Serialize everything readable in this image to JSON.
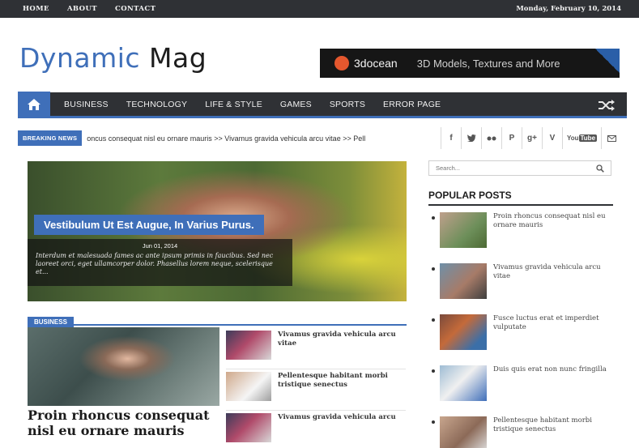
{
  "topbar": {
    "links": [
      "HOME",
      "ABOUT",
      "CONTACT"
    ],
    "date": "Monday, February 10, 2014"
  },
  "header": {
    "logo_part1": "Dynamic",
    "logo_part2": "Mag",
    "banner_brand": "3docean",
    "banner_text": "3D Models, Textures and More"
  },
  "nav": {
    "items": [
      "BUSINESS",
      "TECHNOLOGY",
      "LIFE & STYLE",
      "GAMES",
      "SPORTS",
      "ERROR PAGE"
    ],
    "accent": "#3f6fb9",
    "bar_color": "#2f3135"
  },
  "breaking": {
    "label": "BREAKING NEWS",
    "ticker": "oncus consequat nisl eu ornare mauris  >> Vivamus gravida vehicula arcu vitae  >> Pell",
    "social_icons": [
      "facebook-icon",
      "twitter-icon",
      "flickr-icon",
      "pinterest-icon",
      "googleplus-icon",
      "vimeo-icon",
      "youtube-icon",
      "email-icon"
    ]
  },
  "hero": {
    "title": "Vestibulum Ut Est Augue, In Varius Purus.",
    "date": "Jun 01, 2014",
    "excerpt": "Interdum et malesuada fames ac ante ipsum primis in faucibus. Sed nec laoreet orci, eget ullamcorper dolor. Phasellus lorem neque, scelerisque et..."
  },
  "business": {
    "label": "BUSINESS",
    "feature_title": "Proin rhoncus consequat nisl eu ornare mauris",
    "items": [
      "Vivamus gravida vehicula arcu vitae",
      "Pellentesque habitant morbi tristique senectus",
      "Vivamus gravida vehicula arcu"
    ]
  },
  "sidebar": {
    "search_placeholder": "Search...",
    "popular_title": "POPULAR POSTS",
    "popular": [
      "Proin rhoncus consequat nisl eu ornare mauris",
      "Vivamus gravida vehicula arcu vitae",
      "Fusce luctus erat et imperdiet vulputate",
      "Duis quis erat non nunc fringilla",
      "Pellentesque habitant morbi tristique senectus"
    ]
  }
}
